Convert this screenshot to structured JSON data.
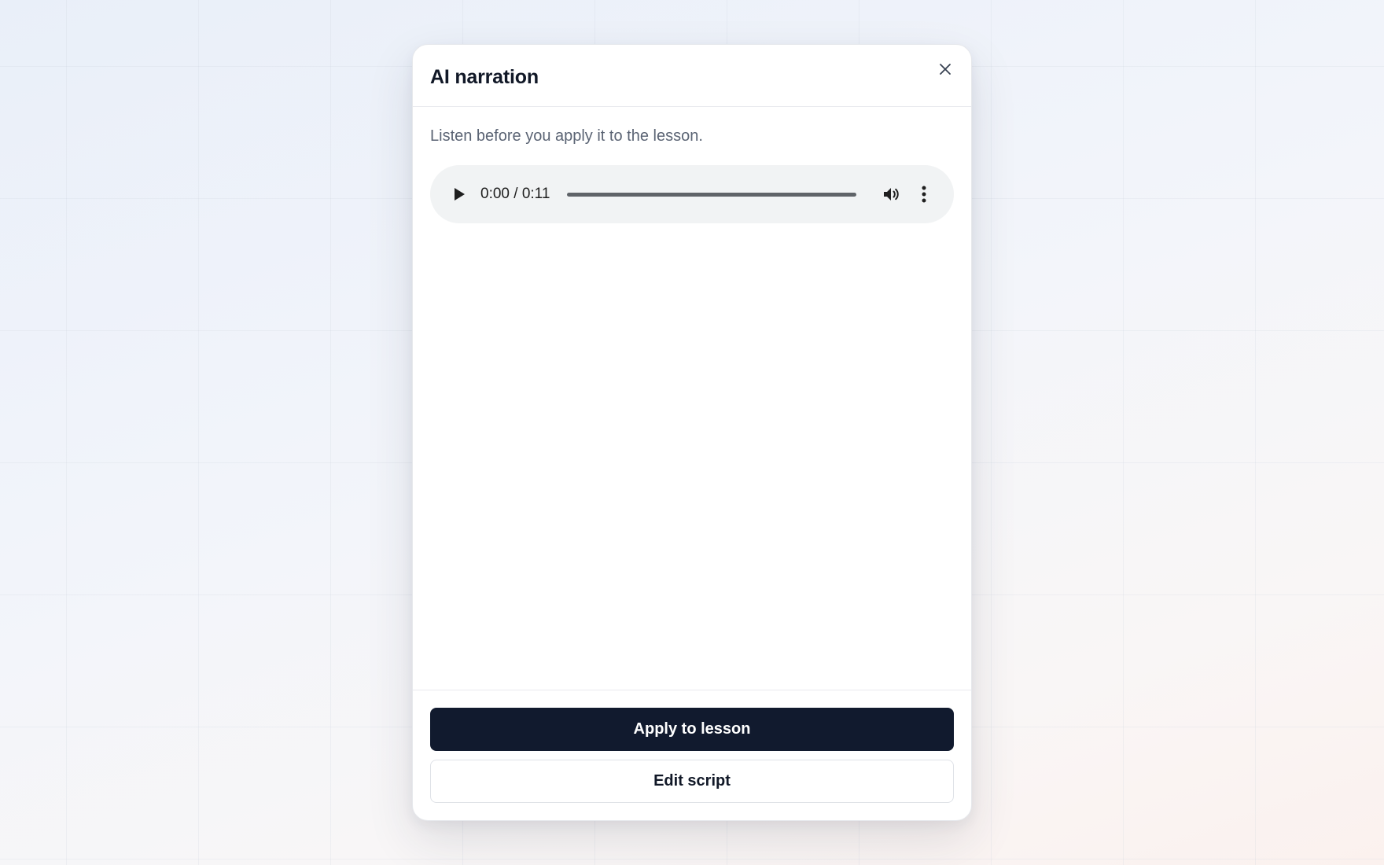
{
  "modal": {
    "title": "AI narration",
    "close_icon": "close-icon",
    "description": "Listen before you apply it to the lesson."
  },
  "audio_player": {
    "time_display": "0:00 / 0:11",
    "progress": 0,
    "icons": {
      "play": "play-icon",
      "volume": "volume-icon",
      "more": "more-vertical-icon"
    }
  },
  "footer": {
    "primary_button": "Apply to lesson",
    "secondary_button": "Edit script"
  },
  "colors": {
    "primary_button_bg": "#111a2e",
    "player_bg": "#f1f3f4",
    "title_text": "#111827",
    "description_text": "#5b6474"
  }
}
